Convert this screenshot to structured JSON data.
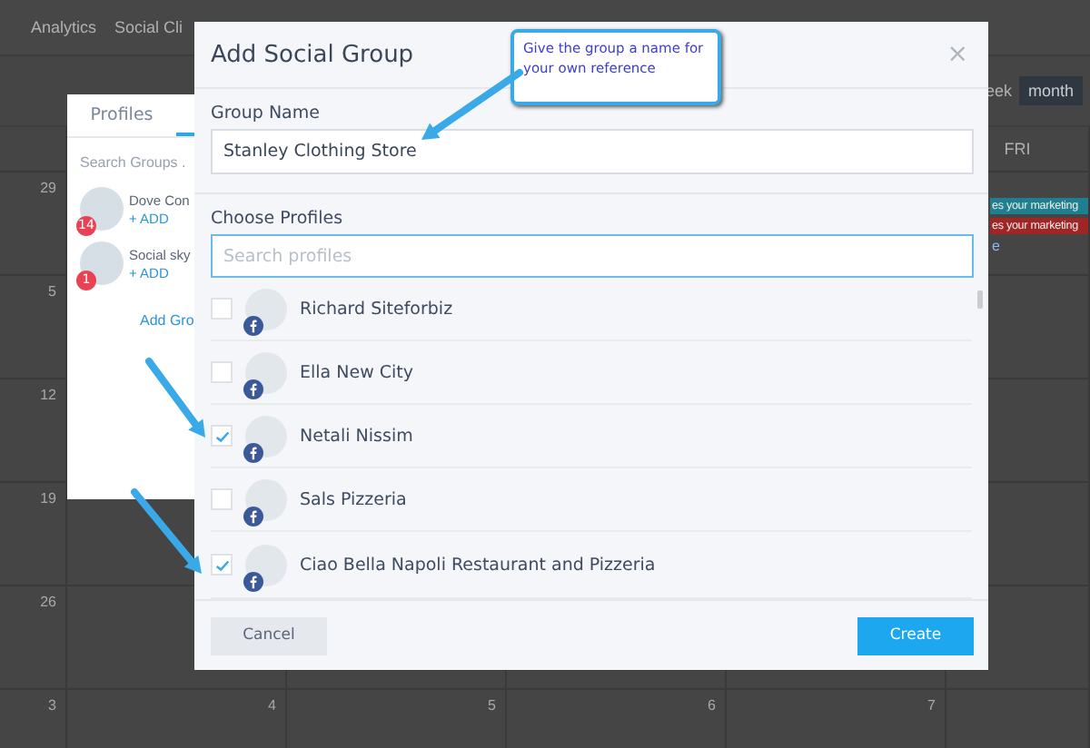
{
  "nav": {
    "items": [
      "Analytics",
      "Social Cli"
    ]
  },
  "calendar": {
    "view_buttons": [
      {
        "label": "eek",
        "selected": false
      },
      {
        "label": "month",
        "selected": true
      }
    ],
    "day_header": "FRI",
    "weeks": [
      [
        "29"
      ],
      [
        "5"
      ],
      [
        "12"
      ],
      [
        "19"
      ],
      [
        "26"
      ],
      [
        "3",
        "4",
        "5",
        "6",
        "7"
      ]
    ],
    "events": [
      {
        "text": "es your marketing",
        "color": "#1f7f8f"
      },
      {
        "text": "es your marketing",
        "color": "#a02525"
      }
    ],
    "more_link": "e"
  },
  "profiles_panel": {
    "tabs": [
      {
        "label": "Profiles",
        "selected": false
      },
      {
        "selected": true
      }
    ],
    "search": {
      "placeholder": "Search Groups ."
    },
    "groups": [
      {
        "name": "Dove Con",
        "count": "14",
        "action": "+ ADD"
      },
      {
        "name": "Social sky",
        "count": "1",
        "action": "+ ADD"
      }
    ],
    "add_link": "Add Gro"
  },
  "dialog": {
    "title": "Add Social Group",
    "close": "×",
    "group_name": {
      "label": "Group Name",
      "value": "Stanley Clothing Store"
    },
    "profiles": {
      "label": "Choose Profiles",
      "search": {
        "placeholder": "Search profiles"
      },
      "items": [
        {
          "name": "Richard Siteforbiz",
          "checked": false
        },
        {
          "name": "Ella New City",
          "checked": false
        },
        {
          "name": "Netali Nissim",
          "checked": true
        },
        {
          "name": "Sals Pizzeria",
          "checked": false
        },
        {
          "name": "Ciao Bella Napoli Restaurant and Pizzeria",
          "checked": true
        }
      ]
    },
    "buttons": [
      {
        "label": "Cancel",
        "kind": "secondary"
      },
      {
        "label": "Create",
        "kind": "primary"
      }
    ]
  },
  "callout": {
    "text": "Give the group a name for your own reference"
  }
}
